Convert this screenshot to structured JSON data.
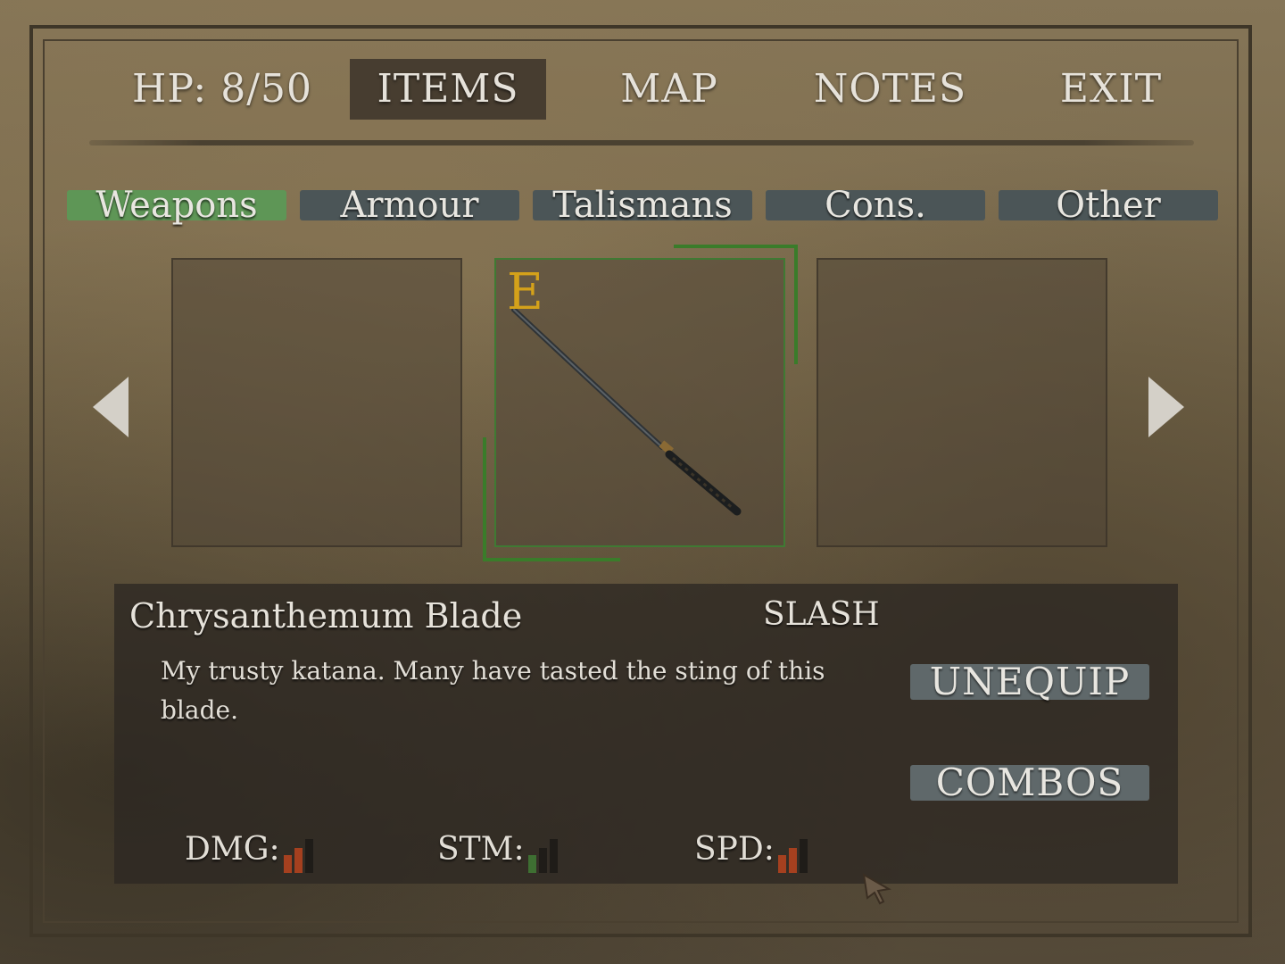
{
  "topnav": {
    "hp_label": "HP:  8/50",
    "hp_current": 8,
    "hp_max": 50,
    "tabs": [
      {
        "label": "ITEMS",
        "active": true
      },
      {
        "label": "MAP",
        "active": false
      },
      {
        "label": "NOTES",
        "active": false
      },
      {
        "label": "EXIT",
        "active": false
      }
    ]
  },
  "categories": [
    {
      "label": "Weapons",
      "active": true
    },
    {
      "label": "Armour",
      "active": false
    },
    {
      "label": "Talismans",
      "active": false
    },
    {
      "label": "Cons.",
      "active": false
    },
    {
      "label": "Other",
      "active": false
    }
  ],
  "carousel": {
    "slots": [
      {
        "item": null
      },
      {
        "item": "katana",
        "equipped": true,
        "equipped_mark": "E"
      },
      {
        "item": null
      }
    ]
  },
  "item": {
    "name": "Chrysanthemum Blade",
    "type": "SLASH",
    "description": "My trusty katana. Many have tasted the sting of this blade.",
    "actions": {
      "unequip": "UNEQUIP",
      "combos": "COMBOS"
    },
    "stats": [
      {
        "label": "DMG:",
        "level": 2,
        "max": 3,
        "color": "#a5401f"
      },
      {
        "label": "STM:",
        "level": 1,
        "max": 3,
        "color": "#3e6f32"
      },
      {
        "label": "SPD:",
        "level": 2,
        "max": 3,
        "color": "#a5401f"
      }
    ]
  },
  "colors": {
    "active_tab": "#5e9656",
    "inactive_tab": "#4b5557",
    "equip_mark": "#d4a11a",
    "equip_border": "#3a7c2a"
  }
}
